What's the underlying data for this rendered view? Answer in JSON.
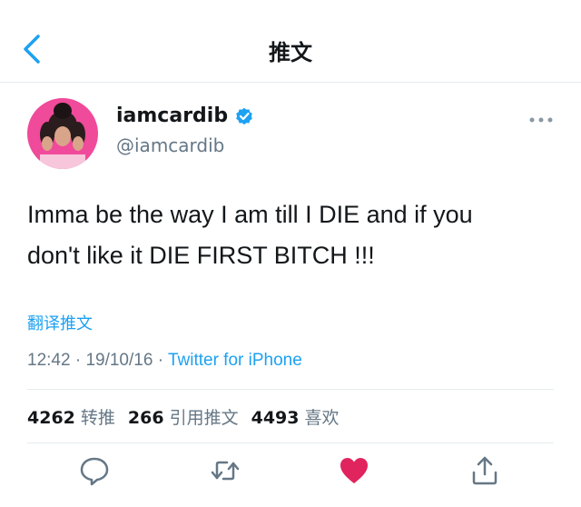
{
  "header": {
    "title": "推文",
    "back_icon": "chevron-left-icon"
  },
  "user": {
    "display_name": "iamcardib",
    "handle": "@iamcardib",
    "verified": true,
    "verified_color": "#1da1f2",
    "avatar_bg": "#f04a9a"
  },
  "tweet": {
    "line1": "Imma be the way I am till I DIE and if you",
    "line2": "don't like it DIE FIRST BITCH !!!"
  },
  "translate_label": "翻译推文",
  "meta": {
    "time": "12:42",
    "date": "19/10/16",
    "separator": "·",
    "source": "Twitter for iPhone"
  },
  "stats": {
    "retweets": {
      "count": "4262",
      "label": "转推"
    },
    "quotes": {
      "count": "266",
      "label": "引用推文"
    },
    "likes": {
      "count": "4493",
      "label": "喜欢"
    }
  },
  "actions": {
    "reply_icon": "reply-icon",
    "retweet_icon": "retweet-icon",
    "like_icon": "heart-icon",
    "like_color": "#e0245e",
    "share_icon": "share-icon"
  },
  "colors": {
    "accent": "#1da1f2",
    "secondary_text": "#657786"
  }
}
